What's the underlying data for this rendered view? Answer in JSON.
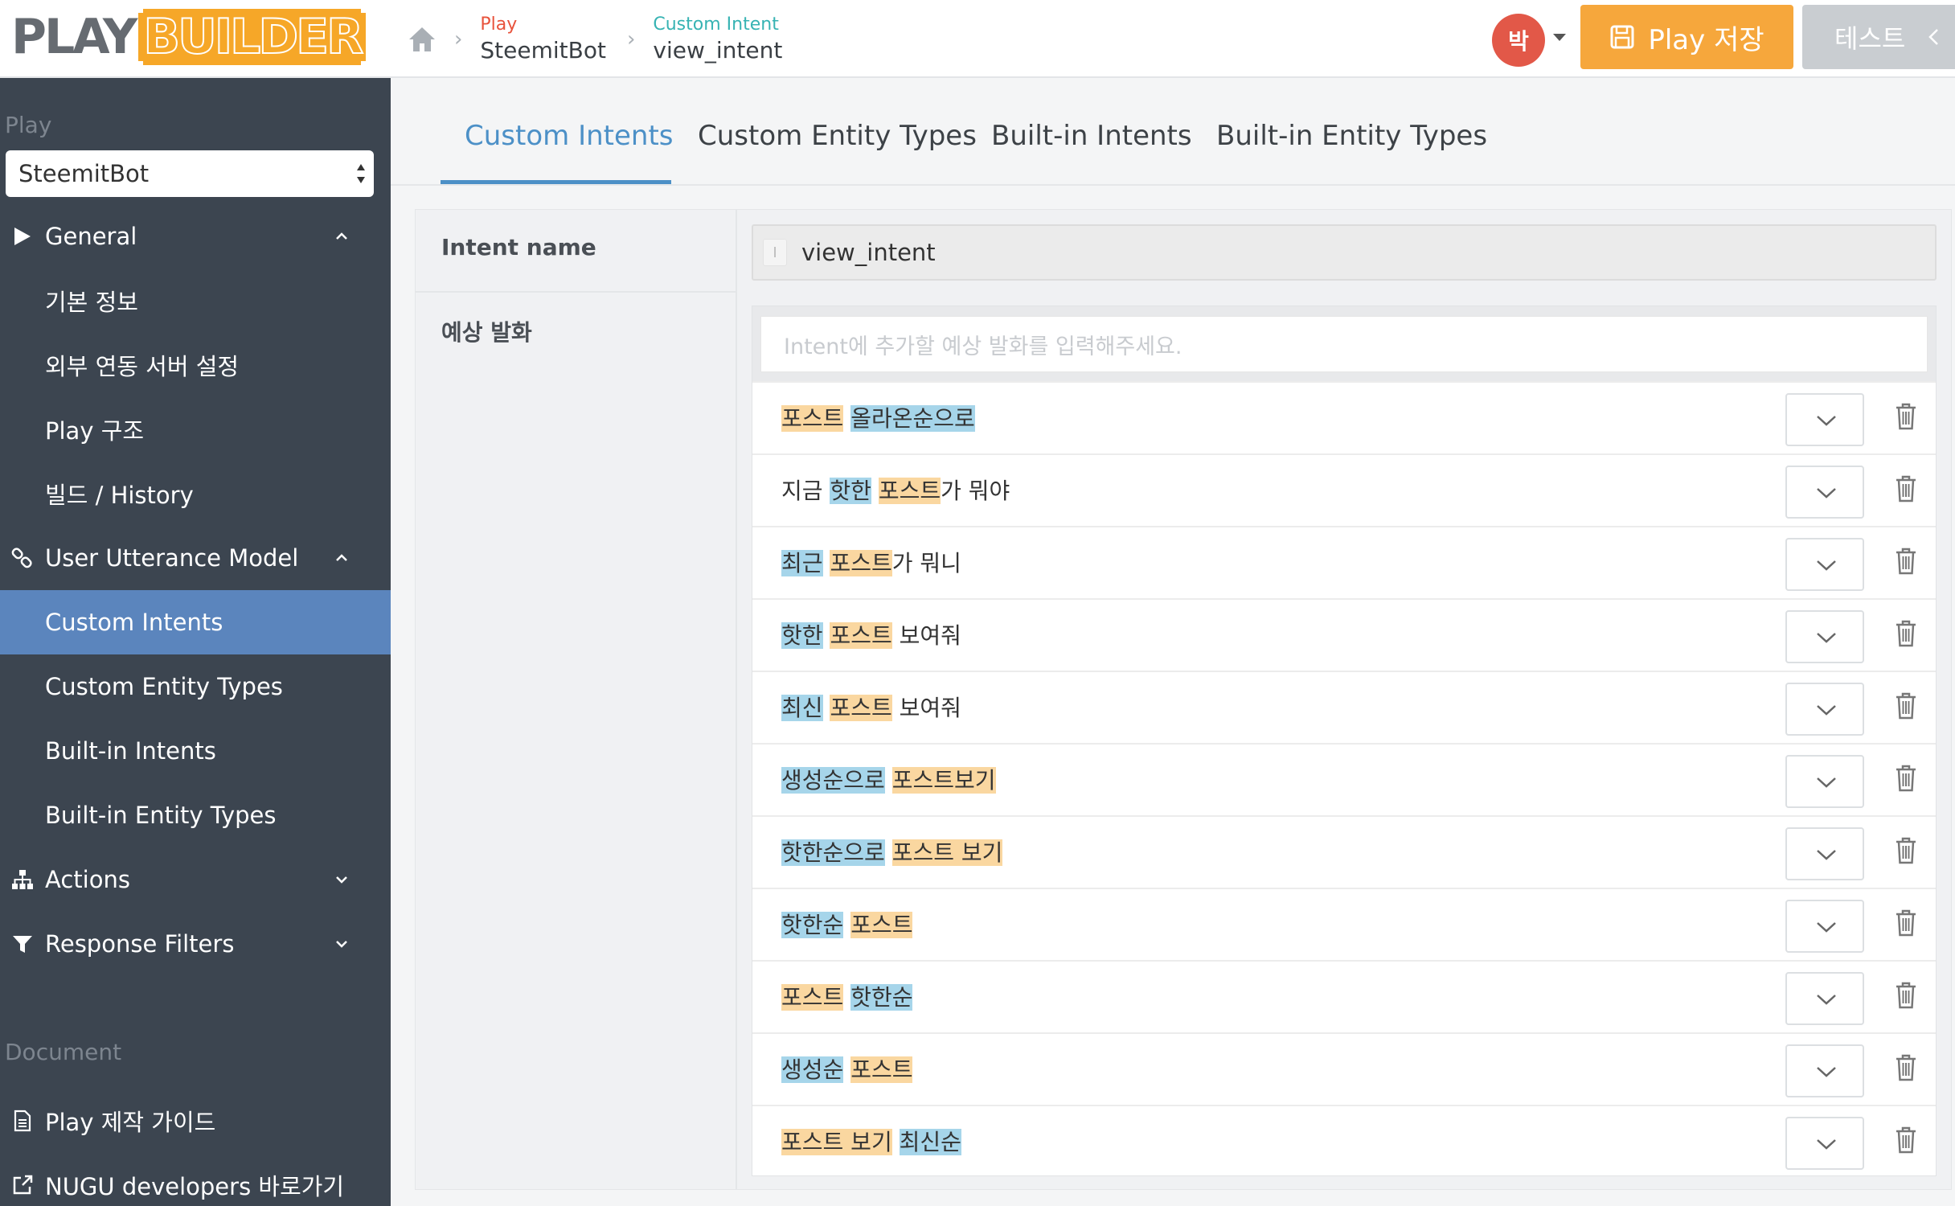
{
  "header": {
    "logo_left": "PLAY",
    "logo_right": "BUILDER",
    "breadcrumbs": [
      {
        "small": "Play",
        "big": "SteemitBot"
      },
      {
        "small": "Custom Intent",
        "big": "view_intent"
      }
    ],
    "avatar_initial": "박",
    "save_label": "Play 저장",
    "test_label": "테스트"
  },
  "sidebar": {
    "play_section_label": "Play",
    "play_select_value": "SteemitBot",
    "items": [
      {
        "label": "General",
        "icon": "triangle-right-icon",
        "expanded": true
      },
      {
        "label": "기본 정보"
      },
      {
        "label": "외부 연동 서버 설정"
      },
      {
        "label": "Play 구조"
      },
      {
        "label": "빌드 / History"
      },
      {
        "label": "User Utterance Model",
        "icon": "link-icon",
        "expanded": true
      },
      {
        "label": "Custom Intents",
        "active": true
      },
      {
        "label": "Custom Entity Types"
      },
      {
        "label": "Built-in Intents"
      },
      {
        "label": "Built-in Entity Types"
      },
      {
        "label": "Actions",
        "icon": "sitemap-icon",
        "expanded": false
      },
      {
        "label": "Response Filters",
        "icon": "filter-icon",
        "expanded": false
      }
    ],
    "document_section_label": "Document",
    "doc_items": [
      {
        "label": "Play 제작 가이드",
        "icon": "document-icon"
      },
      {
        "label": "NUGU developers 바로가기",
        "icon": "external-link-icon"
      }
    ]
  },
  "tabs": [
    "Custom Intents",
    "Custom Entity Types",
    "Built-in Intents",
    "Built-in Entity Types"
  ],
  "form": {
    "intent_name_label": "Intent name",
    "intent_name_icon_glyph": "I",
    "intent_name_value": "view_intent",
    "utterance_label": "예상 발화",
    "utterance_placeholder": "Intent에 추가할 예상 발화를 입력해주세요."
  },
  "utterances": [
    [
      {
        "t": "포스트",
        "h": "o"
      },
      {
        "t": " "
      },
      {
        "t": "올라온순으로",
        "h": "b"
      }
    ],
    [
      {
        "t": "지금 "
      },
      {
        "t": "핫한",
        "h": "b"
      },
      {
        "t": " "
      },
      {
        "t": "포스트",
        "h": "o"
      },
      {
        "t": "가 뭐야"
      }
    ],
    [
      {
        "t": "최근",
        "h": "b"
      },
      {
        "t": " "
      },
      {
        "t": "포스트",
        "h": "o"
      },
      {
        "t": "가 뭐니"
      }
    ],
    [
      {
        "t": "핫한",
        "h": "b"
      },
      {
        "t": " "
      },
      {
        "t": "포스트",
        "h": "o"
      },
      {
        "t": " 보여줘"
      }
    ],
    [
      {
        "t": "최신",
        "h": "b"
      },
      {
        "t": " "
      },
      {
        "t": "포스트",
        "h": "o"
      },
      {
        "t": " 보여줘"
      }
    ],
    [
      {
        "t": "생성순으로",
        "h": "b"
      },
      {
        "t": " "
      },
      {
        "t": "포스트보기",
        "h": "o"
      }
    ],
    [
      {
        "t": "핫한순으로",
        "h": "b"
      },
      {
        "t": " "
      },
      {
        "t": "포스트 보기",
        "h": "o"
      }
    ],
    [
      {
        "t": "핫한순",
        "h": "b"
      },
      {
        "t": " "
      },
      {
        "t": "포스트",
        "h": "o"
      }
    ],
    [
      {
        "t": "포스트",
        "h": "o"
      },
      {
        "t": " "
      },
      {
        "t": "핫한순",
        "h": "b"
      }
    ],
    [
      {
        "t": "생성순",
        "h": "b"
      },
      {
        "t": " "
      },
      {
        "t": "포스트",
        "h": "o"
      }
    ],
    [
      {
        "t": "포스트 보기",
        "h": "o"
      },
      {
        "t": " "
      },
      {
        "t": "최신순",
        "h": "b"
      }
    ]
  ],
  "colors": {
    "accent_orange": "#f6a73c",
    "sidebar_bg": "#3c4550",
    "sidebar_active": "#5b85bd",
    "tab_active": "#4c90c7",
    "entity_orange": "#fad7a0",
    "entity_blue": "#a6d5ea"
  }
}
